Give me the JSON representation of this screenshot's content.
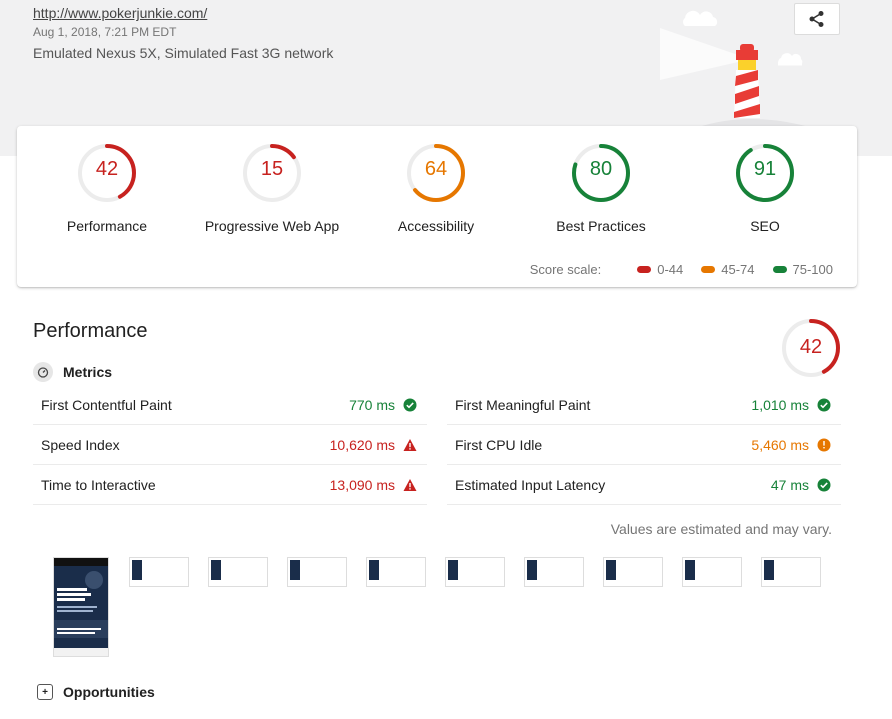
{
  "header": {
    "url": "http://www.pokerjunkie.com/",
    "date": "Aug 1, 2018, 7:21 PM EDT",
    "environment": "Emulated Nexus 5X, Simulated Fast 3G network"
  },
  "colors": {
    "fail": "#c7221f",
    "average": "#e67700",
    "pass": "#178239"
  },
  "summary": [
    {
      "label": "Performance",
      "score": "42",
      "fraction": 0.42,
      "status": "fail"
    },
    {
      "label": "Progressive Web App",
      "score": "15",
      "fraction": 0.15,
      "status": "fail"
    },
    {
      "label": "Accessibility",
      "score": "64",
      "fraction": 0.64,
      "status": "average"
    },
    {
      "label": "Best Practices",
      "score": "80",
      "fraction": 0.8,
      "status": "pass"
    },
    {
      "label": "SEO",
      "score": "91",
      "fraction": 0.91,
      "status": "pass"
    }
  ],
  "scale": {
    "title": "Score scale:",
    "fail": "0-44",
    "average": "45-74",
    "pass": "75-100"
  },
  "performance": {
    "title": "Performance",
    "score": "42",
    "metrics_title": "Metrics",
    "metrics_left": [
      {
        "name": "First Contentful Paint",
        "value": "770 ms",
        "status": "pass"
      },
      {
        "name": "Speed Index",
        "value": "10,620 ms",
        "status": "fail"
      },
      {
        "name": "Time to Interactive",
        "value": "13,090 ms",
        "status": "fail"
      }
    ],
    "metrics_right": [
      {
        "name": "First Meaningful Paint",
        "value": "1,010 ms",
        "status": "pass"
      },
      {
        "name": "First CPU Idle",
        "value": "5,460 ms",
        "status": "average"
      },
      {
        "name": "Estimated Input Latency",
        "value": "47 ms",
        "status": "pass"
      }
    ],
    "estimate_note": "Values are estimated and may vary.",
    "opportunities_title": "Opportunities"
  },
  "icons": {
    "share": "share-icon",
    "metrics": "stopwatch-icon",
    "opportunities": "opportunities-icon"
  }
}
